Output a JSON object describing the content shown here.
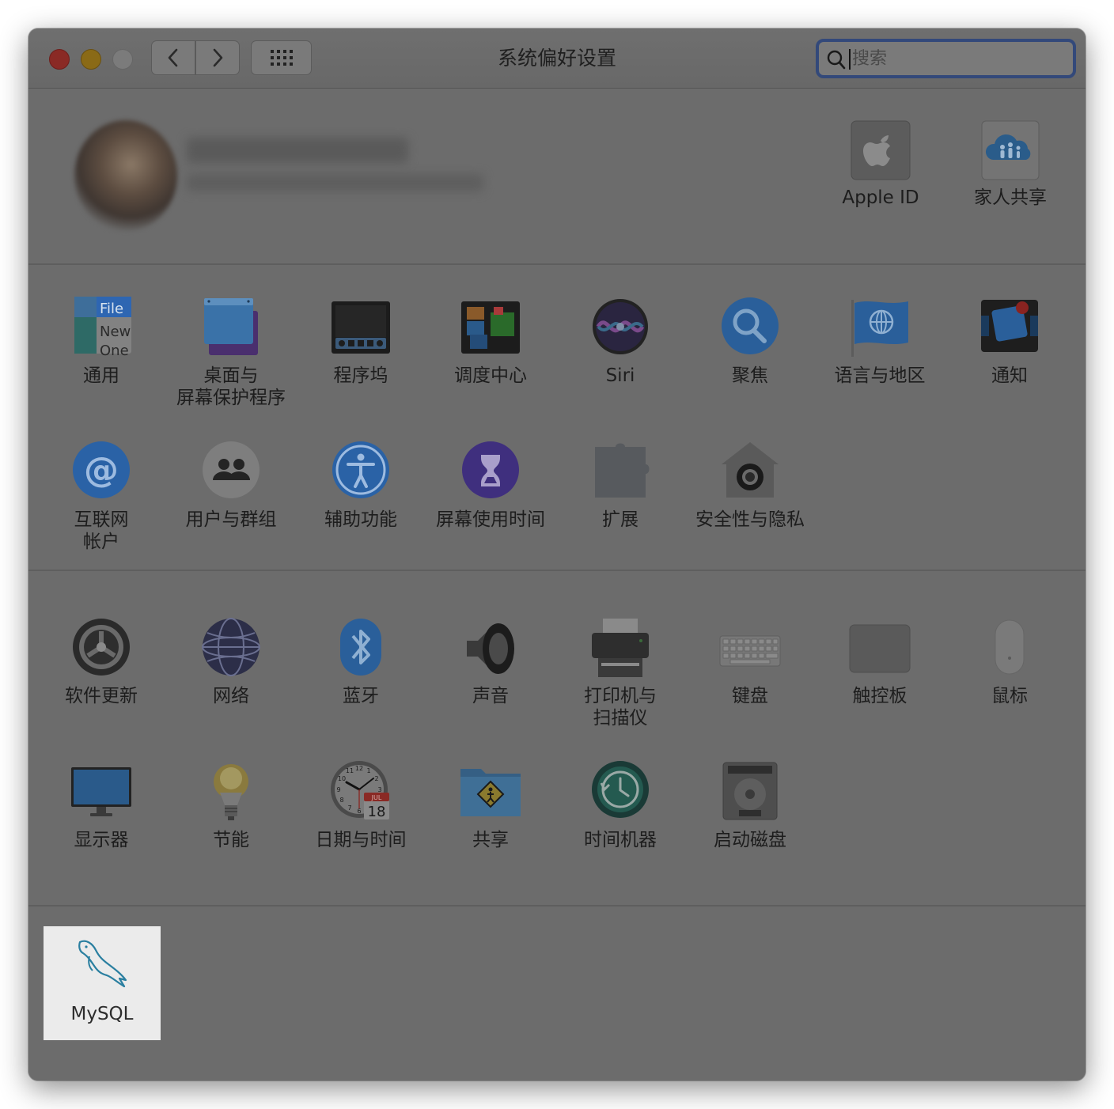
{
  "window": {
    "title": "系统偏好设置"
  },
  "search": {
    "placeholder": "搜索",
    "value": ""
  },
  "toolbar": {
    "back_icon": "chevron-left-icon",
    "forward_icon": "chevron-right-icon",
    "grid_icon": "grid-icon"
  },
  "profile": {
    "apple_id_label": "Apple ID",
    "family_label": "家人共享"
  },
  "personal": [
    {
      "id": "general",
      "label": "通用"
    },
    {
      "id": "desktop",
      "label": "桌面与\n屏幕保护程序"
    },
    {
      "id": "dock",
      "label": "程序坞"
    },
    {
      "id": "mission",
      "label": "调度中心"
    },
    {
      "id": "siri",
      "label": "Siri"
    },
    {
      "id": "spotlight",
      "label": "聚焦"
    },
    {
      "id": "language",
      "label": "语言与地区"
    },
    {
      "id": "notifications",
      "label": "通知"
    },
    {
      "id": "internet",
      "label": "互联网\n帐户"
    },
    {
      "id": "users",
      "label": "用户与群组"
    },
    {
      "id": "accessibility",
      "label": "辅助功能"
    },
    {
      "id": "screentime",
      "label": "屏幕使用时间"
    },
    {
      "id": "extensions",
      "label": "扩展"
    },
    {
      "id": "security",
      "label": "安全性与隐私"
    }
  ],
  "hardware": [
    {
      "id": "software-update",
      "label": "软件更新"
    },
    {
      "id": "network",
      "label": "网络"
    },
    {
      "id": "bluetooth",
      "label": "蓝牙"
    },
    {
      "id": "sound",
      "label": "声音"
    },
    {
      "id": "printers",
      "label": "打印机与\n扫描仪"
    },
    {
      "id": "keyboard",
      "label": "键盘"
    },
    {
      "id": "trackpad",
      "label": "触控板"
    },
    {
      "id": "mouse",
      "label": "鼠标"
    },
    {
      "id": "displays",
      "label": "显示器"
    },
    {
      "id": "energy",
      "label": "节能"
    },
    {
      "id": "datetime",
      "label": "日期与时间"
    },
    {
      "id": "sharing",
      "label": "共享"
    },
    {
      "id": "timemachine",
      "label": "时间机器"
    },
    {
      "id": "startup",
      "label": "启动磁盘"
    }
  ],
  "general_icon_text": {
    "line1": "File",
    "line2": "New",
    "line3": "One"
  },
  "calendar_icon_text": {
    "month": "JUL",
    "day": "18"
  },
  "clock_numbers": {
    "twelve": "12",
    "eleven": "11",
    "one": "1",
    "ten": "10",
    "two": "2",
    "nine": "9",
    "three": "3",
    "eight": "8",
    "seven": "7",
    "six": "6",
    "five": "5",
    "four": "4"
  },
  "other": {
    "mysql_label": "MySQL"
  }
}
